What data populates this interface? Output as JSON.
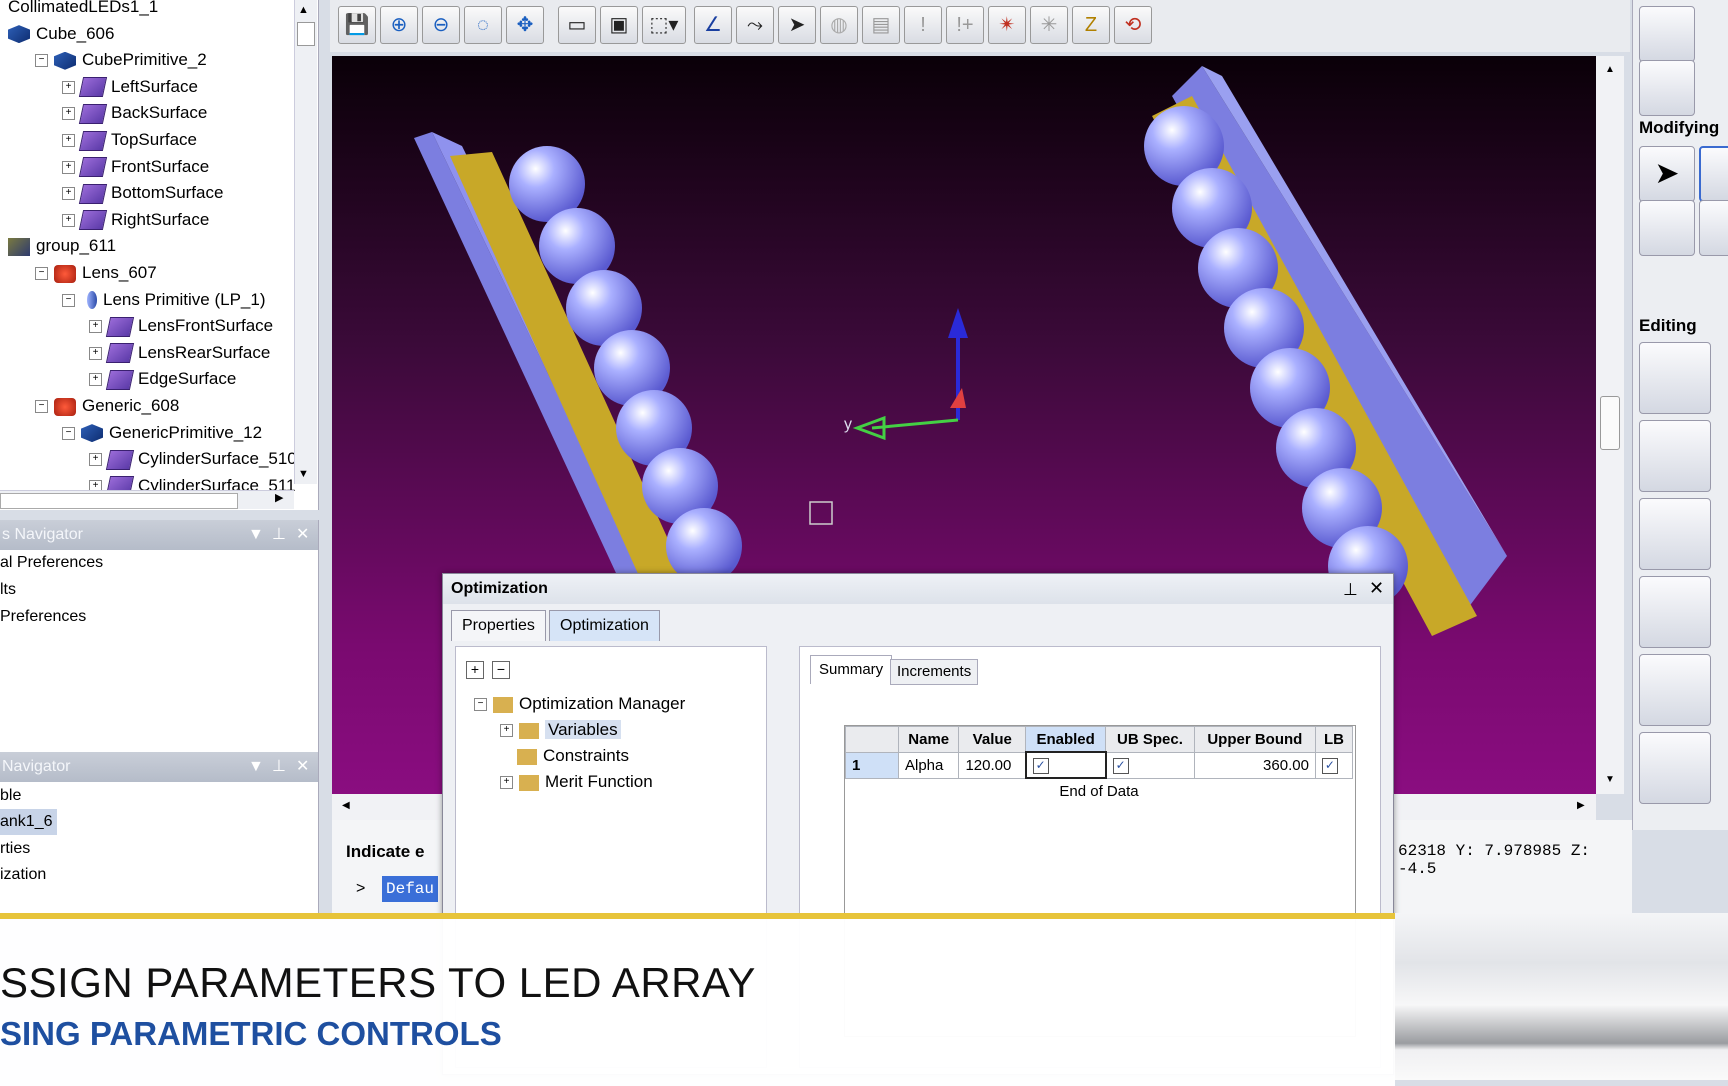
{
  "tree": {
    "items": [
      {
        "label": "CollimatedLEDs1_1",
        "icon": "none",
        "level": 0,
        "expander": ""
      },
      {
        "label": "Cube_606",
        "icon": "cube",
        "level": 0,
        "expander": ""
      },
      {
        "label": "CubePrimitive_2",
        "icon": "cube",
        "level": 1,
        "expander": "−"
      },
      {
        "label": "LeftSurface",
        "icon": "surface",
        "level": 2,
        "expander": "+"
      },
      {
        "label": "BackSurface",
        "icon": "surface",
        "level": 2,
        "expander": "+"
      },
      {
        "label": "TopSurface",
        "icon": "surface",
        "level": 2,
        "expander": "+"
      },
      {
        "label": "FrontSurface",
        "icon": "surface",
        "level": 2,
        "expander": "+"
      },
      {
        "label": "BottomSurface",
        "icon": "surface",
        "level": 2,
        "expander": "+"
      },
      {
        "label": "RightSurface",
        "icon": "surface",
        "level": 2,
        "expander": "+"
      },
      {
        "label": "group_611",
        "icon": "group",
        "level": 0,
        "expander": ""
      },
      {
        "label": "Lens_607",
        "icon": "red",
        "level": 1,
        "expander": "−"
      },
      {
        "label": "Lens Primitive (LP_1)",
        "icon": "lens",
        "level": 2,
        "expander": "−"
      },
      {
        "label": "LensFrontSurface",
        "icon": "surface",
        "level": 3,
        "expander": "+"
      },
      {
        "label": "LensRearSurface",
        "icon": "surface",
        "level": 3,
        "expander": "+"
      },
      {
        "label": "EdgeSurface",
        "icon": "surface",
        "level": 3,
        "expander": "+"
      },
      {
        "label": "Generic_608",
        "icon": "red",
        "level": 1,
        "expander": "−"
      },
      {
        "label": "GenericPrimitive_12",
        "icon": "cube",
        "level": 2,
        "expander": "−"
      },
      {
        "label": "CylinderSurface_510",
        "icon": "surface",
        "level": 3,
        "expander": "+"
      },
      {
        "label": "CylinderSurface_511",
        "icon": "surface",
        "level": 3,
        "expander": "+"
      }
    ]
  },
  "panels": {
    "files_nav_title": "s Navigator",
    "files_nav_items": [
      "al Preferences",
      "lts",
      "Preferences"
    ],
    "nav_title": "Navigator",
    "nav_items": [
      "ble",
      "ank1_6",
      "rties",
      "ization"
    ]
  },
  "viewport": {
    "axis_y_label": "y",
    "status_coords": "62318 Y:   7.978985 Z:   -4.5",
    "indicate_label": "Indicate e",
    "command_prompt": ">",
    "command_value": "Defau"
  },
  "palette": {
    "modifying_label": "Modifying",
    "editing_label": "Editing"
  },
  "dialog": {
    "title": "Optimization",
    "tabs": [
      "Properties",
      "Optimization"
    ],
    "tree": {
      "root": "Optimization Manager",
      "children": [
        "Variables",
        "Constraints",
        "Merit Function"
      ]
    },
    "subtabs": [
      "Summary",
      "Increments"
    ],
    "table": {
      "headers": [
        "Name",
        "Value",
        "Enabled",
        "UB Spec.",
        "Upper Bound",
        "LB"
      ],
      "rows": [
        {
          "index": "1",
          "name": "Alpha",
          "value": "120.00",
          "enabled": "✓",
          "ub_spec": "✓",
          "upper_bound": "360.00",
          "lb": "✓"
        }
      ],
      "footer": "End of Data"
    }
  },
  "banner": {
    "line1": "SSIGN PARAMETERS TO LED ARRAY",
    "line2": "SING PARAMETRIC CONTROLS",
    "line1_color": "#111111",
    "line2_color": "#1e4fa0",
    "accent": "#e7c43a"
  }
}
